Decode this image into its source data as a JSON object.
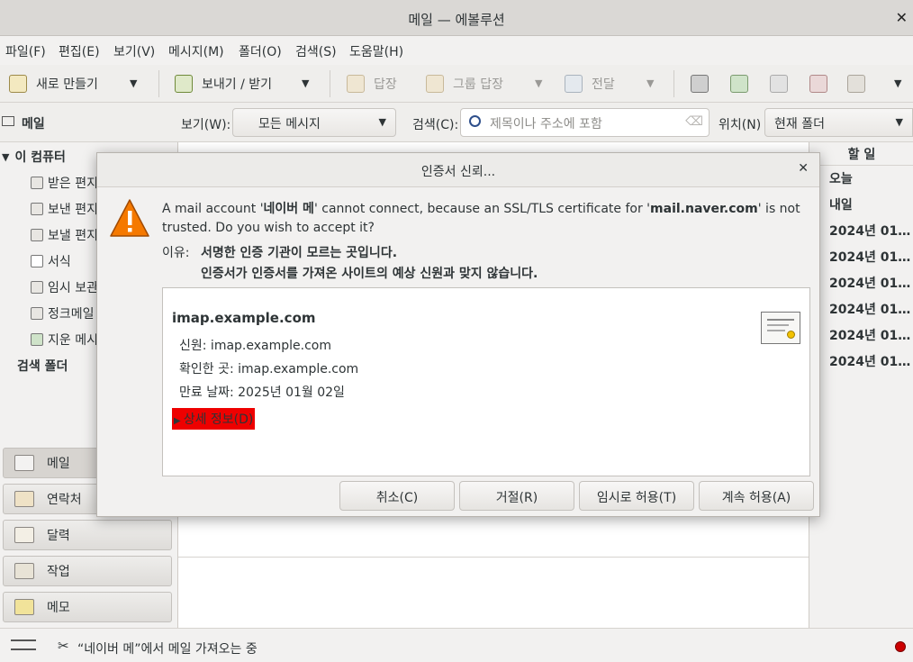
{
  "window": {
    "title": "메일 — 에볼루션"
  },
  "menu": [
    "파일(F)",
    "편집(E)",
    "보기(V)",
    "메시지(M)",
    "폴더(O)",
    "검색(S)",
    "도움말(H)"
  ],
  "toolbar": {
    "new_label": "새로 만들기",
    "send_receive_label": "보내기 / 받기",
    "reply_label": "답장",
    "group_reply_label": "그룹 답장",
    "forward_label": "전달"
  },
  "filter": {
    "view_label": "보기(W):",
    "view_value": "모든 메시지",
    "search_label": "검색(C):",
    "search_placeholder": "제목이나 주소에 포함",
    "location_label": "위치(N)",
    "location_value": "현재 폴더"
  },
  "sidebar": {
    "header": "메일",
    "tree_root": "이 컴퓨터",
    "folders": [
      "받은 편지",
      "보낸 편지",
      "보낼 편지",
      "서식",
      "임시 보관",
      "정크메일",
      "지운 메시"
    ],
    "search_folder": "검색 폴더",
    "switchers": [
      "메일",
      "연락처",
      "달력",
      "작업",
      "메모"
    ]
  },
  "todo": {
    "header": "할 일",
    "items": [
      "오늘",
      "내일",
      "2024년 01…",
      "2024년 01…",
      "2024년 01…",
      "2024년 01…",
      "2024년 01…",
      "2024년 01…"
    ]
  },
  "status": {
    "text": "“네이버 메”에서 메일 가져오는 중"
  },
  "dialog": {
    "title": "인증서 신뢰...",
    "message_pre": "A mail account '",
    "account": "네이버 메",
    "message_mid": "' cannot connect, because an SSL/TLS certificate for '",
    "host": "mail.naver.com",
    "message_post": "' is not trusted. Do you wish to accept it?",
    "reason_label": "이유:",
    "reasons": [
      "서명한 인증 기관이 모르는 곳입니다.",
      "인증서가 인증서를 가져온 사이트의 예상 신원과 맞지 않습니다."
    ],
    "cert": {
      "name": "imap.example.com",
      "identity": "신원: imap.example.com",
      "verified_by": "확인한 곳: imap.example.com",
      "expires": "만료 날짜: 2025년 01월 02일",
      "details_label": "상세 정보(D)"
    },
    "buttons": {
      "cancel": "취소(C)",
      "reject": "거절(R)",
      "temp_accept": "임시로 허용(T)",
      "accept": "계속 허용(A)"
    }
  },
  "colors": {
    "details_highlight": "#ee0000",
    "warning": "#f57900"
  }
}
